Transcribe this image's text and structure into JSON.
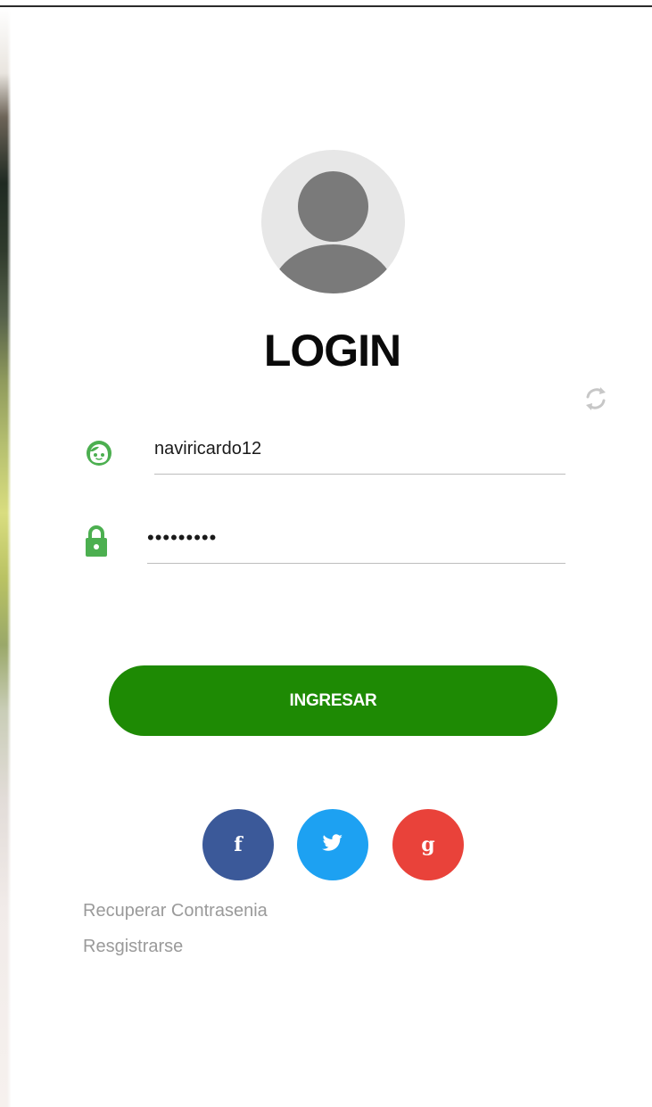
{
  "login": {
    "title": "LOGIN",
    "username": {
      "value": "naviricardo12"
    },
    "password": {
      "value": "navi12345"
    },
    "submit_label": "INGRESAR"
  },
  "social": [
    {
      "name": "facebook",
      "glyph": "f",
      "color": "#3b5999"
    },
    {
      "name": "twitter",
      "glyph": "twitter-bird",
      "color": "#1da1f2"
    },
    {
      "name": "google",
      "glyph": "g",
      "color": "#e9423a"
    }
  ],
  "links": {
    "recover": "Recuperar Contrasenia",
    "register": "Resgistrarse"
  },
  "colors": {
    "accent": "#1e8a04",
    "icon_green": "#4caf50",
    "link_gray": "#9a9a9a",
    "refresh_gray": "#c7c7c7"
  },
  "icons": [
    "avatar-icon",
    "refresh-icon",
    "user-face-icon",
    "lock-icon",
    "facebook-icon",
    "twitter-icon",
    "google-icon"
  ]
}
